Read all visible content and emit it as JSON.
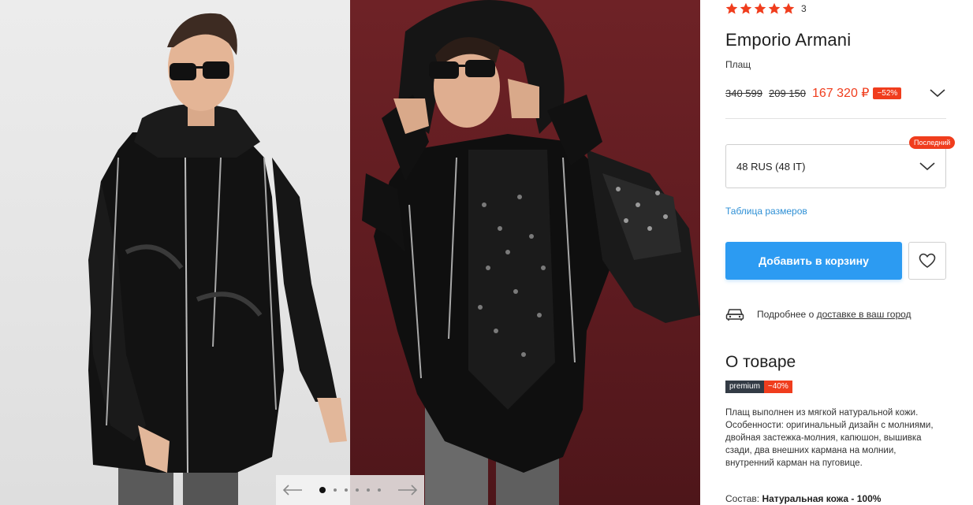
{
  "gallery": {
    "photos": [
      "product-photo-front",
      "product-photo-hood"
    ],
    "slide_count": 6,
    "active_slide": 1
  },
  "product": {
    "rating_stars": 5,
    "review_count": "3",
    "brand": "Emporio Armani",
    "category": "Плащ",
    "price": {
      "old_1": "340 599",
      "old_2": "209 150",
      "current": "167 320 ₽",
      "discount": "−52%"
    },
    "size": {
      "selected": "48 RUS (48 IT)",
      "badge": "Последний"
    },
    "size_table_link": "Таблица размеров",
    "add_to_cart": "Добавить в корзину",
    "delivery": {
      "prefix": "Подробнее о",
      "link": "доставке в ваш город"
    }
  },
  "about": {
    "title": "О товаре",
    "premium_label": "premium",
    "premium_discount": "−40%",
    "description": "Плащ выполнен из мягкой натуральной кожи. Особенности: оригинальный дизайн с молниями, двойная застежка-молния, капюшон, вышивка сзади, два внешних кармана на молнии, внутренний карман на пуговице.",
    "composition_label": "Состав:",
    "composition_value": "Натуральная кожа - 100%"
  },
  "colors": {
    "accent": "#f03d1d",
    "button": "#2c9bf2",
    "link": "#2d8fd5",
    "premium": "#333b45"
  }
}
